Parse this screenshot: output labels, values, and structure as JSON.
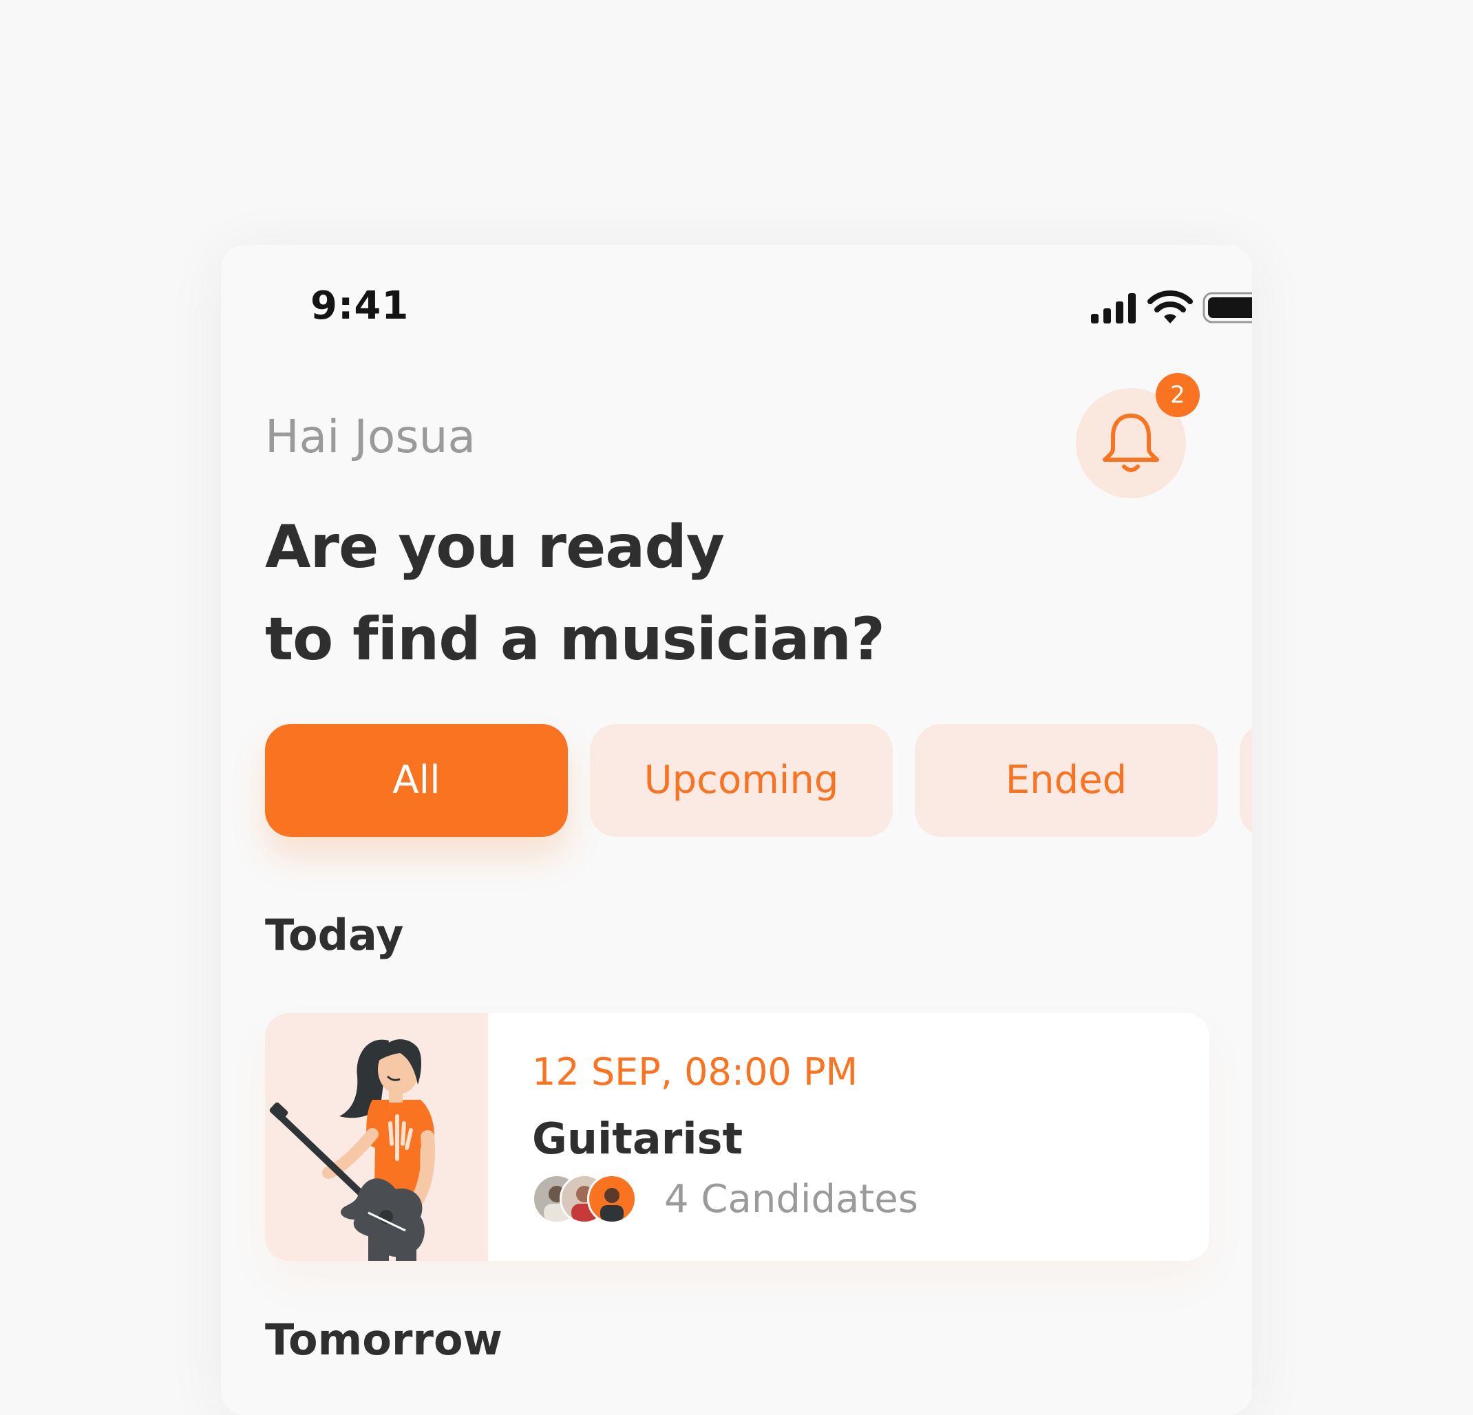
{
  "status_bar": {
    "time": "9:41",
    "icons": [
      "signal-icon",
      "wifi-icon",
      "battery-icon"
    ]
  },
  "header": {
    "greeting": "Hai Josua",
    "headline_line1": "Are you ready",
    "headline_line2": "to find a musician?",
    "notification_count": "2"
  },
  "tabs": [
    {
      "label": "All",
      "active": true
    },
    {
      "label": "Upcoming",
      "active": false
    },
    {
      "label": "Ended",
      "active": false
    }
  ],
  "sections": {
    "today": "Today",
    "tomorrow": "Tomorrow"
  },
  "cards": [
    {
      "date": "12 SEP, 08:00 PM",
      "title": "Guitarist",
      "candidates": "4 Candidates",
      "illustration": "guitarist-illustration"
    }
  ],
  "colors": {
    "accent": "#f97320",
    "accent_light": "#faeae3",
    "text_dark": "#2f2f2f",
    "text_muted": "#9a9a9a",
    "background": "#f9f9f9"
  }
}
